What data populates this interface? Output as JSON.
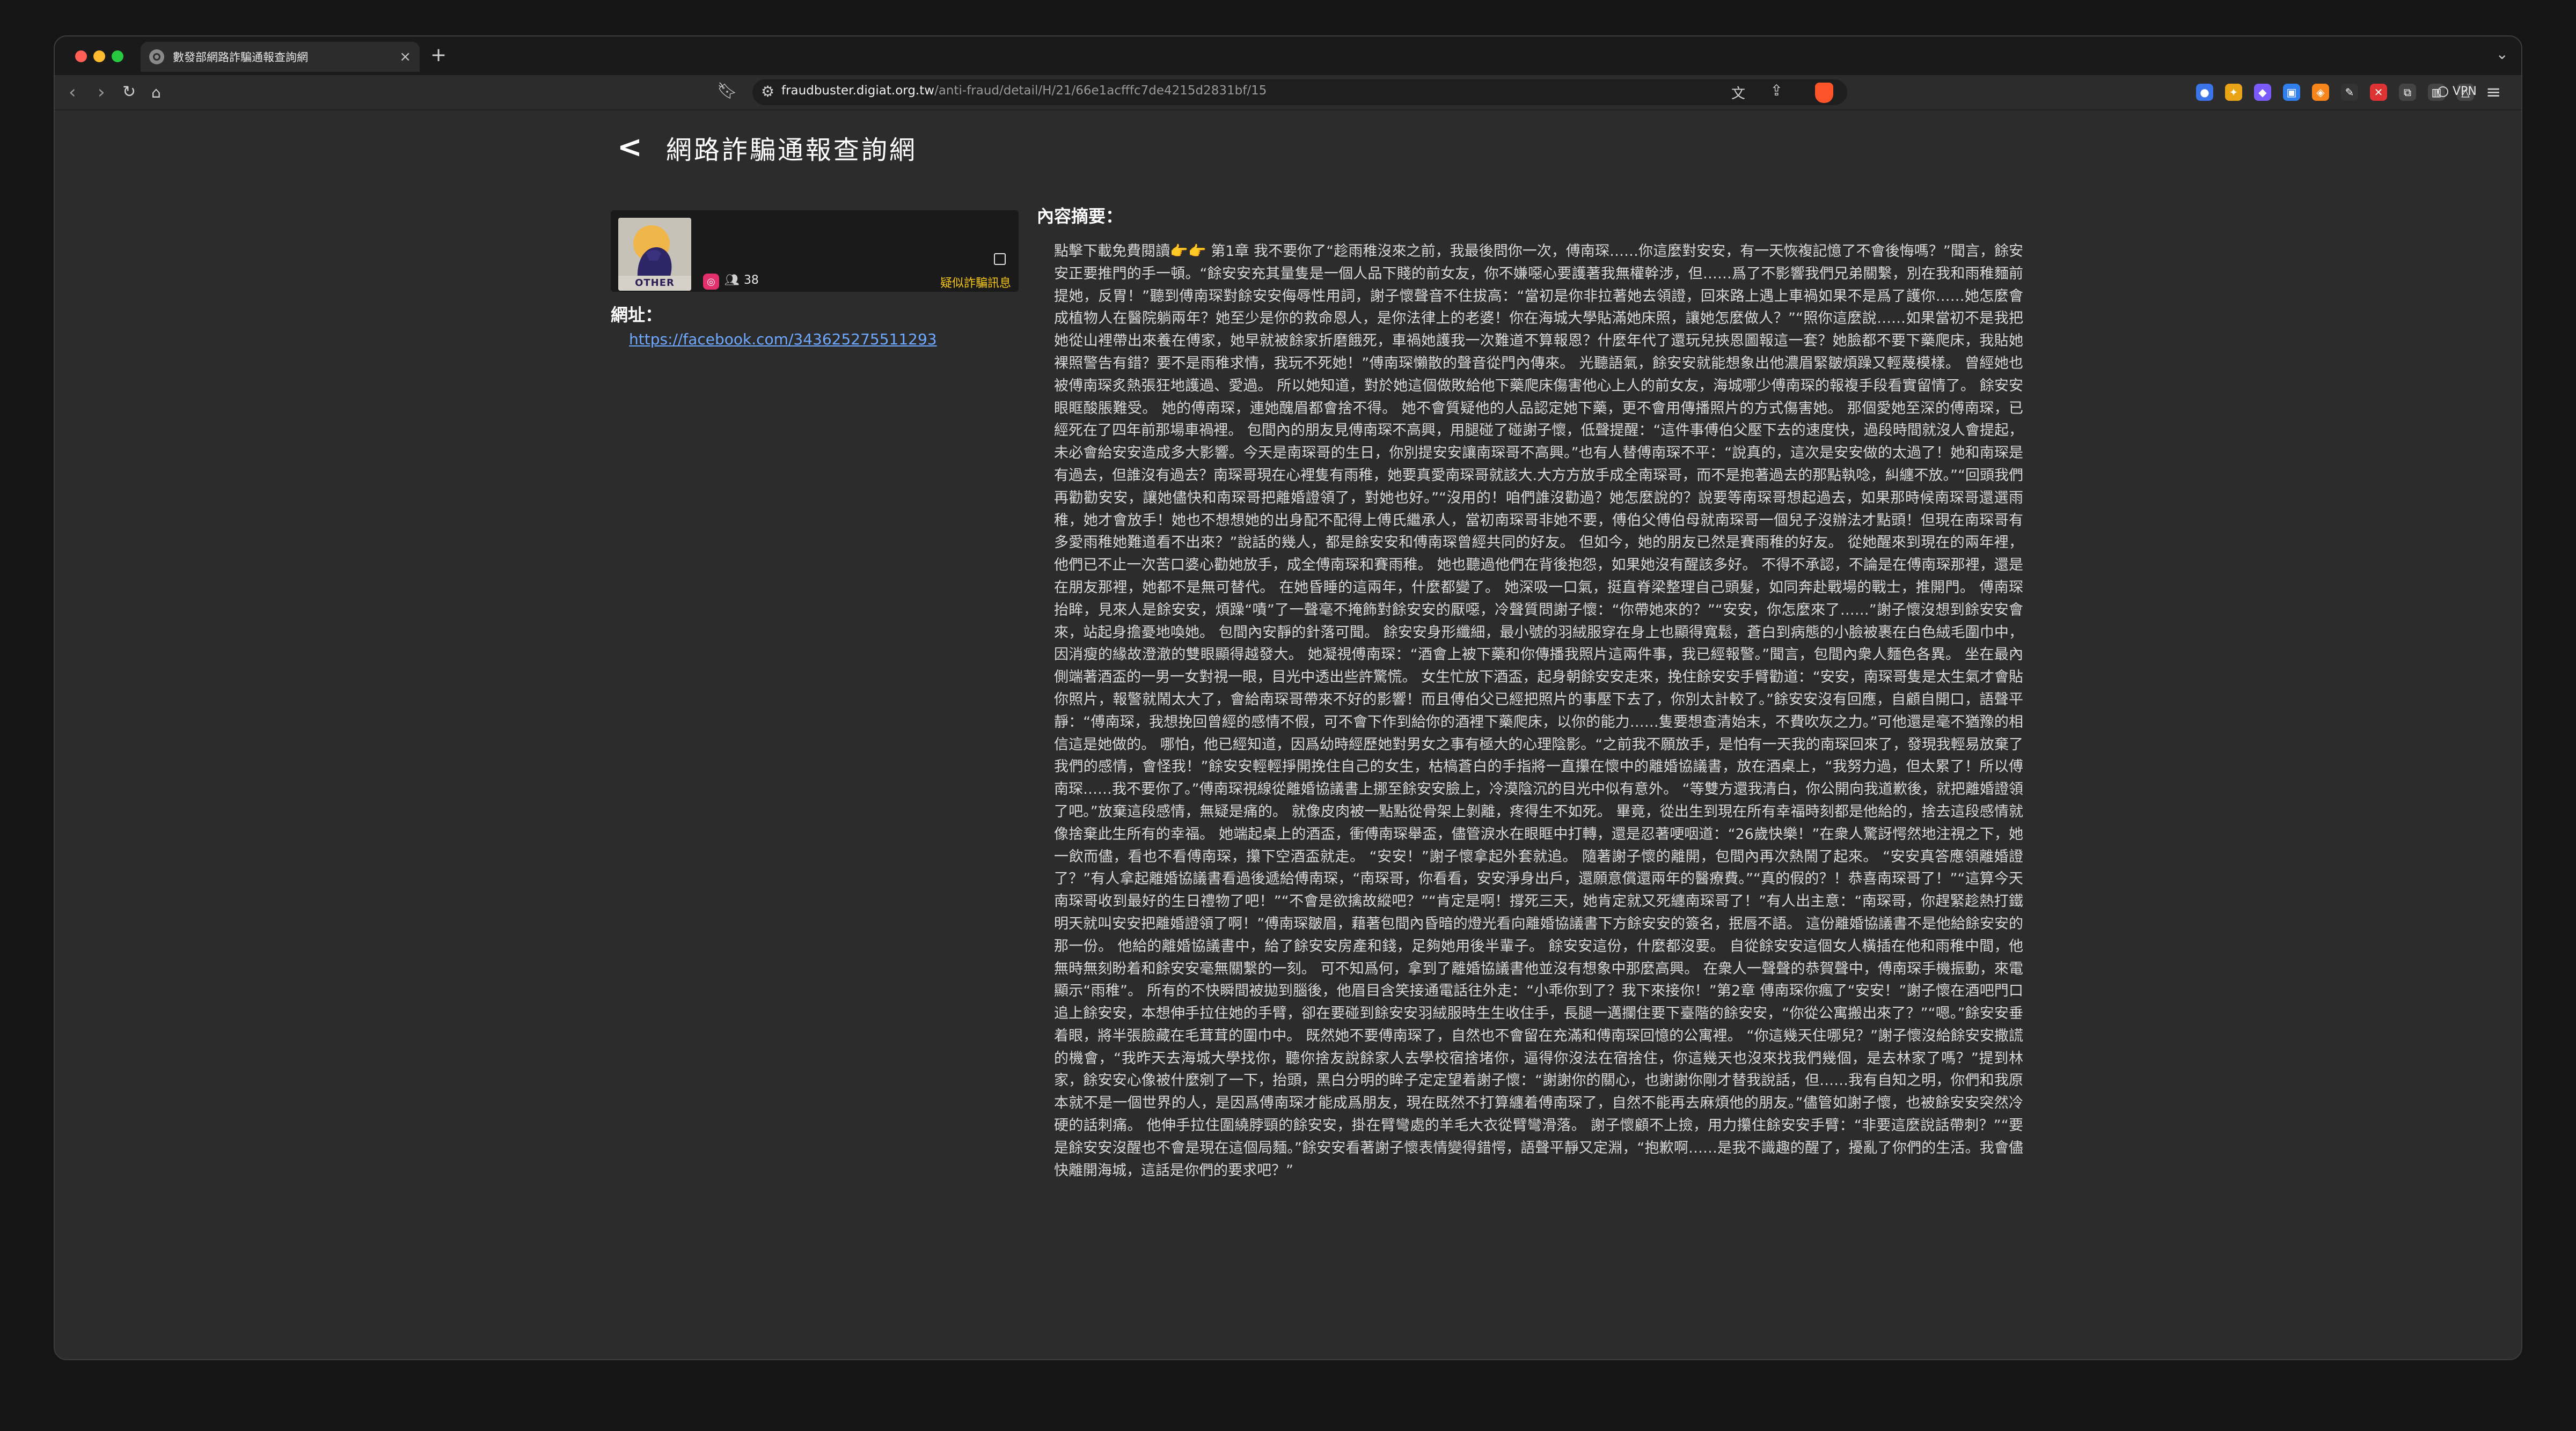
{
  "browser": {
    "tab_title": "數發部網路詐騙通報查詢網",
    "url_host": "fraudbuster.digiat.org.tw",
    "url_path": "/anti-fraud/detail/H/21/66e1acfffc7de4215d2831bf/15",
    "vpn_label": "VPN",
    "icons": [
      "back-icon",
      "forward-icon",
      "reload-icon",
      "home-icon",
      "bookmark-icon",
      "translate-icon",
      "share-icon",
      "brave-shield-icon",
      "menu-icon"
    ]
  },
  "page": {
    "title": "網路詐騙通報查詢網",
    "card": {
      "avatar_tag": "OTHER",
      "platform": "instagram-icon",
      "count": "38",
      "suspect_label": "疑似詐騙訊息"
    },
    "url_label": "網址：",
    "url_value": "https://facebook.com/343625275511293",
    "summary_label": "內容摘要：",
    "summary_text": "點擊下載免費閱讀👉👉 第1章 我不要你了“趁雨稚沒來之前，我最後問你一次，傅南琛……你這麼對安安，有一天恢複記憶了不會後悔嗎？”聞言，餘安安正要推門的手一頓。“餘安安充其量隻是一個人品下賤的前女友，你不嫌噁心要護著我無權幹涉，但……爲了不影響我們兄弟關繫，別在我和雨稚麵前提她，反胃！”聽到傅南琛對餘安安侮辱性用詞，謝子懷聲音不住拔高：“當初是你非拉著她去領證，回來路上遇上車禍如果不是爲了護你……她怎麼會成植物人在醫院躺兩年？她至少是你的救命恩人，是你法律上的老婆！你在海城大學貼滿她床照，讓她怎麼做人？”“照你這麼說……如果當初不是我把她從山裡帶出來養在傅家，她早就被餘家折磨餓死，車禍她護我一次難道不算報恩？什麼年代了還玩兒挾恩圖報這一套？她臉都不要下藥爬床，我貼她裸照警告有錯？要不是雨稚求情，我玩不死她！”傅南琛懶散的聲音從門內傳來。 光聽語氣，餘安安就能想象出他濃眉緊皺煩躁又輕蔑模樣。 曾經她也被傅南琛炙熱張狂地護過、愛過。 所以她知道，對於她這個做敗給他下藥爬床傷害他心上人的前女友，海城哪少傅南琛的報複手段看實留情了。 餘安安眼眶酸脹難受。 她的傅南琛，連她醜眉都會捨不得。 她不會質疑他的人品認定她下藥，更不會用傳播照片的方式傷害她。 那個愛她至深的傅南琛，已經死在了四年前那場車禍裡。 包間內的朋友見傅南琛不高興，用腿碰了碰謝子懷，低聲提醒：“這件事傅伯父壓下去的速度快，過段時間就沒人會提起，未必會給安安造成多大影響。今天是南琛哥的生日，你別提安安讓南琛哥不高興。”也有人替傅南琛不平：“說真的，這次是安安做的太過了！她和南琛是有過去，但誰沒有過去？南琛哥現在心裡隻有雨稚，她要真愛南琛哥就該大.大方方放手成全南琛哥，而不是抱著過去的那點執唸，糾纏不放。”“回頭我們再勸勸安安，讓她儘快和南琛哥把離婚證領了，對她也好。”“沒用的！咱們誰沒勸過？她怎麼說的？說要等南琛哥想起過去，如果那時候南琛哥還選雨稚，她才會放手！她也不想想她的出身配不配得上傅氏繼承人，當初南琛哥非她不要，傅伯父傅伯母就南琛哥一個兒子沒辦法才點頭！但現在南琛哥有多愛雨稚她難道看不出來？”說話的幾人，都是餘安安和傅南琛曾經共同的好友。 但如今，她的朋友已然是賽雨稚的好友。 從她醒來到現在的兩年裡，他們已不止一次苦口婆心勸她放手，成全傅南琛和賽雨稚。 她也聽過他們在背後抱怨，如果她沒有醒該多好。 不得不承認，不論是在傅南琛那裡，還是在朋友那裡，她都不是無可替代。 在她昏睡的這兩年，什麼都變了。 她深吸一口氣，挺直脊梁整理自己頭髮，如同奔赴戰場的戰士，推開門。 傅南琛抬眸，見來人是餘安安，煩躁“嘖”了一聲毫不掩飾對餘安安的厭噁，冷聲質問謝子懷：“你帶她來的？”“安安，你怎麼來了……”謝子懷沒想到餘安安會來，站起身擔憂地喚她。 包間內安靜的針落可聞。 餘安安身形纖細，最小號的羽絨服穿在身上也顯得寬鬆，蒼白到病態的小臉被裹在白色絨毛圍巾中，因消瘦的緣故澄澈的雙眼顯得越發大。 她凝視傅南琛：“酒會上被下藥和你傳播我照片這兩件事，我已經報警。”聞言，包間內衆人麵色各異。 坐在最內側端著酒盃的一男一女對視一眼，目光中透出些許驚慌。 女生忙放下酒盃，起身朝餘安安走來，挽住餘安安手臂勸道：“安安，南琛哥隻是太生氣才會貼你照片，報警就鬧太大了，會給南琛哥帶來不好的影響！而且傅伯父已經把照片的事壓下去了，你別太計較了。”餘安安沒有回應，自顧自開口，語聲平靜：“傅南琛，我想挽回曾經的感情不假，可不會下作到給你的酒裡下藥爬床，以你的能力……隻要想查清始末，不費吹灰之力。”可他還是毫不猶豫的相信這是她做的。 哪怕，他已經知道，因爲幼時經歷她對男女之事有極大的心理陰影。“之前我不願放手，是怕有一天我的南琛回來了，發現我輕易放棄了我們的感情，會怪我！”餘安安輕輕掙開挽住自己的女生，枯槁蒼白的手指將一直攥在懷中的離婚協議書，放在酒桌上，“我努力過，但太累了！所以傅南琛……我不要你了。”傅南琛視線從離婚協議書上挪至餘安安臉上，冷漠陰沉的目光中似有意外。 “等雙方還我清白，你公開向我道歉後，就把離婚證領了吧。”放棄這段感情，無疑是痛的。 就像皮肉被一點點從骨架上剝離，疼得生不如死。 畢竟，從出生到現在所有幸福時刻都是他給的，捨去這段感情就像捨棄此生所有的幸福。 她端起桌上的酒盃，衝傅南琛舉盃，儘管淚水在眼眶中打轉，還是忍著哽咽道：“26歲快樂！”在衆人驚訝愕然地注視之下，她一飲而儘，看也不看傅南琛，攥下空酒盃就走。 “安安！”謝子懷拿起外套就追。 隨著謝子懷的離開，包間內再次熱鬧了起來。 “安安真答應領離婚證了？”有人拿起離婚協議書看過後遞給傅南琛，“南琛哥，你看看，安安淨身出戶，還願意償還兩年的醫療費。”“真的假的？！恭喜南琛哥了！”“這算今天南琛哥收到最好的生日禮物了吧！”“不會是欲擒故縱吧？”“肯定是啊！撐死三天，她肯定就又死纏南琛哥了！”有人出主意：“南琛哥，你趕緊趁熱打鐵明天就叫安安把離婚證領了啊！”傅南琛皺眉，藉著包間內昏暗的燈光看向離婚協議書下方餘安安的簽名，抿唇不語。 這份離婚協議書不是他給餘安安的那一份。 他給的離婚協議書中，給了餘安安房產和錢，足夠她用後半輩子。 餘安安這份，什麼都沒要。 自從餘安安這個女人橫插在他和雨稚中間，他無時無刻盼着和餘安安毫無關繫的一刻。 可不知爲何，拿到了離婚協議書他並沒有想象中那麼高興。 在衆人一聲聲的恭賀聲中，傅南琛手機振動，來電顯示“雨稚”。 所有的不快瞬間被拋到腦後，他眉目含笑接通電話往外走：“小乖你到了？我下來接你！”第2章 傅南琛你瘋了“安安！”謝子懷在酒吧門口追上餘安安，本想伸手拉住她的手臂，卻在要碰到餘安安羽絨服時生生收住手，長腿一邁攔住要下臺階的餘安安，“你從公寓搬出來了？”“嗯。”餘安安垂着眼，將半張臉藏在毛茸茸的圍巾中。 既然她不要傅南琛了，自然也不會留在充滿和傅南琛回憶的公寓裡。 “你這幾天住哪兒？”謝子懷沒給餘安安撒謊的機會，“我昨天去海城大學找你，聽你捨友說餘家人去學校宿捨堵你，逼得你沒法在宿捨住，你這幾天也沒來找我們幾個，是去林家了嗎？”提到林家，餘安安心像被什麼剜了一下，抬頭，黑白分明的眸子定定望着謝子懷：“謝謝你的關心，也謝謝你剛才替我說話，但……我有自知之明，你們和我原本就不是一個世界的人，是因爲傅南琛才能成爲朋友，現在既然不打算纏着傅南琛了，自然不能再去麻煩他的朋友。”儘管如謝子懷，也被餘安安突然冷硬的話刺痛。 他伸手拉住圍繞脖頸的餘安安，掛在臂彎處的羊毛大衣從臂彎滑落。 謝子懷顧不上撿，用力攥住餘安安手臂：“非要這麼說話帶刺？”“要是餘安安沒醒也不會是現在這個局麵。”餘安安看著謝子懷表情變得錯愕，語聲平靜又定淵，“抱歉啊……是我不識趣的醒了，擾亂了你們的生活。我會儘快離開海城，這話是你們的要求吧？”"
  }
}
